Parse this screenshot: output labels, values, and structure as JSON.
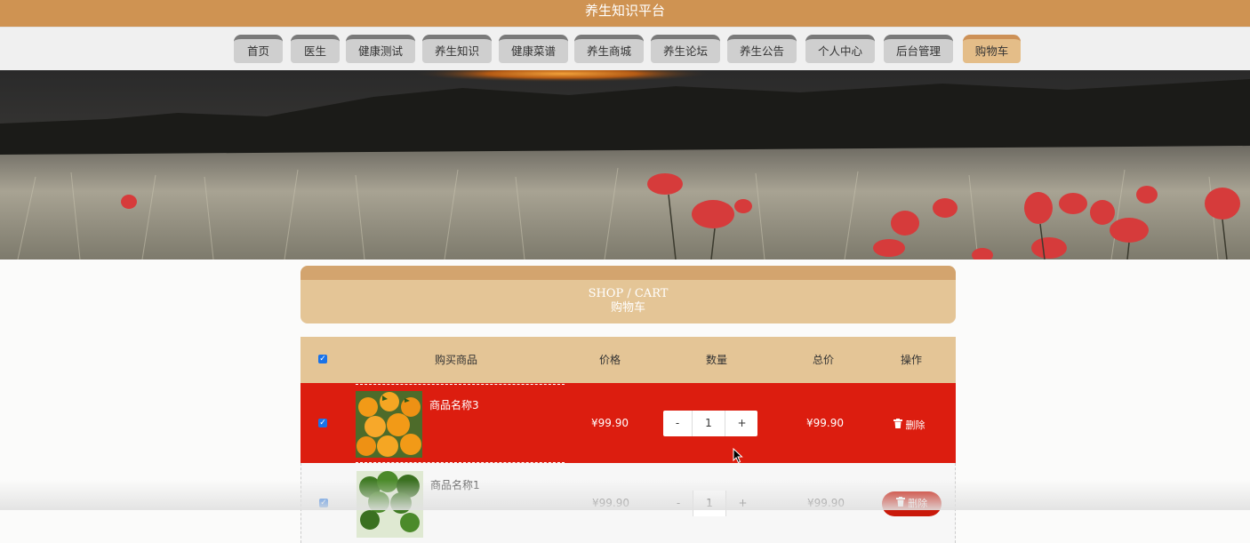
{
  "header": {
    "title": "养生知识平台"
  },
  "nav": {
    "items": [
      {
        "label": "首页"
      },
      {
        "label": "医生"
      },
      {
        "label": "健康测试"
      },
      {
        "label": "养生知识"
      },
      {
        "label": "健康菜谱"
      },
      {
        "label": "养生商城"
      },
      {
        "label": "养生论坛"
      },
      {
        "label": "养生公告"
      },
      {
        "label": "个人中心"
      },
      {
        "label": "后台管理"
      },
      {
        "label": "购物车"
      }
    ],
    "active": "购物车"
  },
  "cart": {
    "title_en": "SHOP / CART",
    "title_cn": "购物车",
    "columns": {
      "product": "购买商品",
      "price": "价格",
      "quantity": "数量",
      "total": "总价",
      "action": "操作"
    },
    "items": [
      {
        "name": "商品名称3",
        "price": "¥99.90",
        "quantity": "1",
        "total": "¥99.90",
        "delete_label": "删除",
        "checked": true,
        "thumb_icon": "orange-fruit-image",
        "minus": "-",
        "plus": "+"
      },
      {
        "name": "商品名称1",
        "price": "¥99.90",
        "quantity": "1",
        "total": "¥99.90",
        "delete_label": "删除",
        "checked": true,
        "thumb_icon": "broccoli-image",
        "minus": "-",
        "plus": "+"
      }
    ]
  },
  "colors": {
    "topbar": "#cf9352",
    "accent": "#e4c596",
    "highlight_row": "#dc1d0f",
    "delete_button": "#c9190a",
    "checkbox": "#1a73e8"
  }
}
